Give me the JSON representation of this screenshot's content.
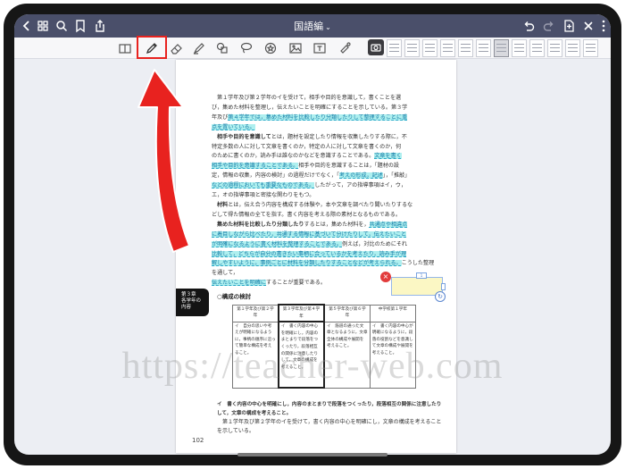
{
  "navbar": {
    "title": "国語編",
    "icons": [
      "back-chevron-icon",
      "grid-icon",
      "search-icon",
      "bookmark-icon",
      "share-icon",
      "undo-icon",
      "redo-icon",
      "add-page-icon",
      "close-icon",
      "more-icon"
    ]
  },
  "toolbar": {
    "tools": [
      "reading-mode",
      "pen",
      "eraser",
      "highlighter",
      "shapes",
      "lasso",
      "elements",
      "image",
      "text-box",
      "laser-pointer"
    ],
    "selected_tool": "pen",
    "highlight_color": "#e8221f"
  },
  "page": {
    "paragraphs": [
      {
        "text": "第１学年及び第２学年のイを受けて，相手や目的を意識して，書くことを選"
      },
      {
        "text": "び，集めた材料を整理し，伝えたいことを明確にすることを示している。第３学"
      },
      {
        "text": "年及び",
        "hl": "第４学年では，集めた材料を比較したり分類したりして整理することに重"
      },
      {
        "hl": "点を置いている。"
      },
      {
        "bold": "相手や目的を意識して",
        "text": "とは，題材を設定したり情報を収集したりする際に，不"
      },
      {
        "text": "特定多数の人に対して文章を書くのか，特定の人に対して文章を書くのか，何"
      },
      {
        "text": "のために書くのか，読み手は誰なのかなどを意識することである。",
        "hl": "文章を書く"
      },
      {
        "hl": "相手や目的を意識することである。",
        "text": "相手や目的を意識することは，「題材の設"
      },
      {
        "text": "定，情報の収集，内容の検討」の過程だけでなく，「",
        "hl": "考えの形成，記述",
        "text2": "」，「推敲」"
      },
      {
        "hl": "などの過程においても重要なものである。",
        "text": "したがって，アの指導事項はイ，ウ，"
      },
      {
        "text": "エ，オの指導事項と密接な関わりをもつ。"
      },
      {
        "bold": "材料",
        "text": "とは，伝え合う内容を構成する体験や，本や文章を調べたり聞いたりするな"
      },
      {
        "text": "どして得た情報の全てを指す。書く内容を考える際の素材となるものである。"
      },
      {
        "bold": "集めた材料を比較したり分類したり",
        "text": "するとは，集めた材料を，",
        "hl": "共通点や相違点"
      },
      {
        "hl": "に着目しながら比べたり，共通する情報に基づいて分けたりして，伝えたいこと"
      },
      {
        "hl": "が明確になるように書く材料を整理することである。",
        "text": "例えば，対比のためにそれ"
      },
      {
        "hl": "比較して，どちらが自分の書きたい事柄に合っているかを考えたり，読み手が理"
      },
      {
        "hl": "解しやすいように，事例ごとに材料を分類したりすることなどが考えられる。",
        "text": "こうした整理を通して，"
      },
      {
        "hl": "伝えたいことを明確に",
        "text": "することが重要である。"
      }
    ],
    "chapter_tab": "第３章\n各学年の\n内容",
    "section_title": "○構成の検討",
    "table": {
      "headers": [
        "第１学年及び第２学年",
        "第３学年及び第４学年",
        "第５学年及び第６学年",
        "中学校第１学年"
      ],
      "cells": [
        "イ　自分の思いや考えが明確になるように，事柄の順序に沿って簡単な構成を考えること。",
        "イ　書く内容の中心を明確にし，内容のまとまりで段落をつくったり，段落相互の関係に注意したりして，文章の構成を考えること。",
        "イ　筋道の通った文章となるように，文章全体の構成や展開を考えること。",
        "イ　書く内容の中心が明確になるように，段落の役割などを意識して文章の構成や展開を考えること。"
      ]
    },
    "bottom_heading": "イ　書く内容の中心を明確にし，内容のまとまりで段落をつくったり，段落相互の関係に注意したりして，文章の構成を考えること。",
    "bottom_body": "第１学年及び第２学年のイを受けて，書く内容の中心を明確にし，文章の構成を考えることを示している。",
    "page_number": "102"
  },
  "overlay": {
    "note_close": "×",
    "note_counter": "1"
  },
  "watermark": "https://teacher-web.com",
  "colors": {
    "navbar": "#4a4f6a",
    "highlight": "#4cdbdb",
    "annotation_arrow": "#e8221f",
    "note": "#fbf7c4"
  }
}
